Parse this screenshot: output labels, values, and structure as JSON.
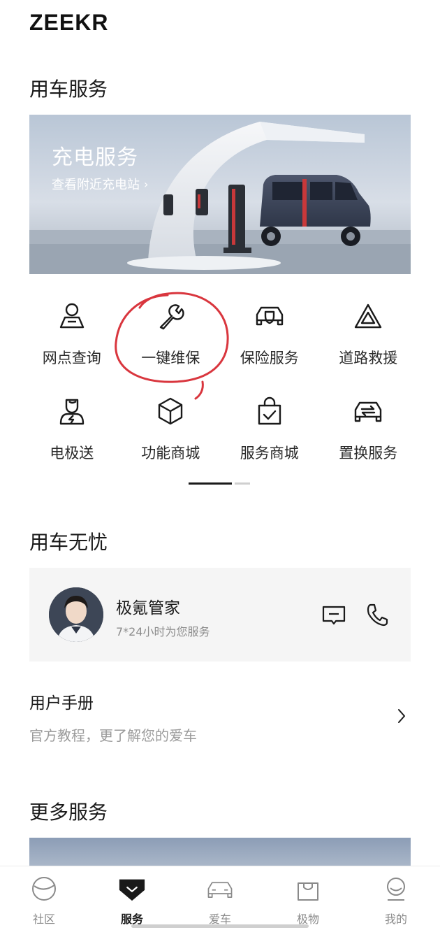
{
  "header": {
    "brand": "ZEEKR"
  },
  "sections": {
    "car_service": "用车服务",
    "worry_free": "用车无忧",
    "more_services": "更多服务"
  },
  "banner": {
    "title": "充电服务",
    "subtitle": "查看附近充电站",
    "chevron": "›"
  },
  "services": [
    {
      "label": "网点查询",
      "icon": "person-location-icon"
    },
    {
      "label": "一键维保",
      "icon": "wrench-icon"
    },
    {
      "label": "保险服务",
      "icon": "car-shield-icon"
    },
    {
      "label": "道路救援",
      "icon": "warning-triangle-icon"
    },
    {
      "label": "电极送",
      "icon": "delivery-person-icon"
    },
    {
      "label": "功能商城",
      "icon": "cube-icon"
    },
    {
      "label": "服务商城",
      "icon": "shopping-bag-check-icon"
    },
    {
      "label": "置换服务",
      "icon": "car-swap-icon"
    }
  ],
  "pager": {
    "pages": 2,
    "active": 0
  },
  "butler": {
    "name": "极氪管家",
    "subtitle": "7*24小时为您服务"
  },
  "manual": {
    "title": "用户手册",
    "subtitle": "官方教程，更了解您的爱车"
  },
  "tabbar": [
    {
      "label": "社区",
      "icon": "planet-icon",
      "active": false
    },
    {
      "label": "服务",
      "icon": "service-badge-icon",
      "active": true
    },
    {
      "label": "爱车",
      "icon": "car-icon",
      "active": false
    },
    {
      "label": "极物",
      "icon": "bag-icon",
      "active": false
    },
    {
      "label": "我的",
      "icon": "profile-icon",
      "active": false
    }
  ],
  "colors": {
    "annotation": "#d9363e",
    "text_primary": "#1a1a1a",
    "text_secondary": "#8c8c8c",
    "card_bg": "#f5f5f5"
  }
}
